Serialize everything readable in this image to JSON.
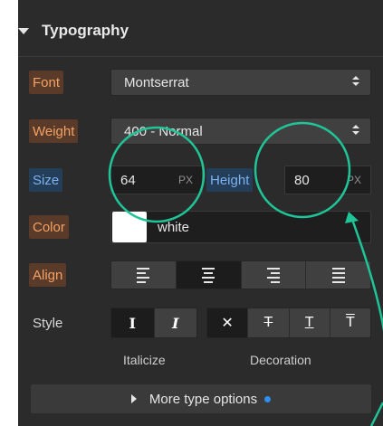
{
  "section": {
    "title": "Typography"
  },
  "font": {
    "label": "Font",
    "value": "Montserrat"
  },
  "weight": {
    "label": "Weight",
    "value": "400 - Normal"
  },
  "size": {
    "label": "Size",
    "value": "64",
    "unit": "PX"
  },
  "height": {
    "label": "Height",
    "value": "80",
    "unit": "PX"
  },
  "color": {
    "label": "Color",
    "value": "white",
    "swatch": "#ffffff"
  },
  "align": {
    "label": "Align",
    "options": [
      "left",
      "center",
      "right",
      "justify"
    ],
    "selected": "center"
  },
  "style": {
    "label": "Style",
    "italic_normal_glyph": "I",
    "italic_italic_glyph": "I",
    "decoration_none_glyph": "✕",
    "decoration_strike_glyph": "T",
    "decoration_underline_glyph": "T",
    "decoration_overline_glyph": "T",
    "italicize_label": "Italicize",
    "decoration_label": "Decoration"
  },
  "more": {
    "label": "More type options"
  },
  "colors": {
    "panel_bg": "#2b2b2b",
    "label_orange": "#f3a265",
    "label_blue": "#7cb2ef",
    "annotation": "#1fc497",
    "indicator_dot": "#2f8ef3"
  }
}
